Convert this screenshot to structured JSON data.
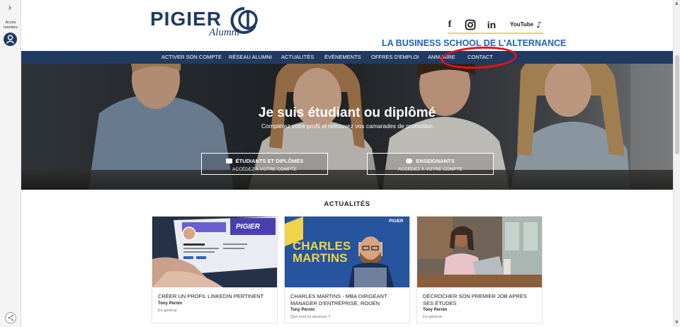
{
  "rail": {
    "toggle_glyph": "›",
    "label_line1": "Accès",
    "label_line2": "membre",
    "avatar_icon": "person-icon",
    "share_icon": "share-icon"
  },
  "header": {
    "logo_word": "PIGIER",
    "logo_sub": "Alumni",
    "tagline": "LA BUSINESS SCHOOL DE L'ALTERNANCE",
    "socials": {
      "facebook": "f",
      "instagram_icon": "instagram-icon",
      "linkedin": "in",
      "youtube": "YouTube",
      "tiktok": "♪"
    }
  },
  "nav": {
    "items": [
      "ACTIVER SON COMPTE",
      "RÉSEAU ALUMNI",
      "ACTUALITÉS",
      "ÉVÉNEMENTS",
      "OFFRES D'EMPLOI",
      "ANNUAIRE",
      "CONTACT"
    ]
  },
  "hero": {
    "title": "Je suis étudiant ou diplômé",
    "subtitle": "Complétez votre profil et retrouvez vos camarades de promotion",
    "buttons": [
      {
        "label": "ÉTUDIANTS ET DIPLÔMÉS",
        "sub": "ACCÉDEZ À VOTRE COMPTE",
        "icon": "book-icon"
      },
      {
        "label": "ENSEIGNANTS",
        "sub": "ACCÉDEZ À VOTRE COMPTE",
        "icon": "chat-icon"
      }
    ]
  },
  "news": {
    "title": "ACTUALITÉS",
    "cards": [
      {
        "title": "CRÉER UN PROFIL LINKEDIN PERTINENT",
        "author": "Tony Pernin",
        "category": "En général",
        "image_brand": "PIGIER"
      },
      {
        "title": "CHARLES MARTINS - MBA DIRIGEANT MANAGER D'ENTREPRISE, ROUEN",
        "author": "Tony Pernin",
        "category": "Que sont-ils devenus ?",
        "image_text_1": "CHARLES",
        "image_text_2": "MARTINS",
        "image_tag": "PORTRAIT A",
        "image_brand": "PIGIER"
      },
      {
        "title": "DÉCROCHER SON PREMIER JOB APRÈS SES ÉTUDES",
        "author": "Tony Pernin",
        "category": "En général"
      }
    ]
  },
  "colors": {
    "navy": "#213a61",
    "brand_blue": "#1f63b5",
    "accent_yellow": "#f2d44b",
    "highlight_red": "#e8121b"
  }
}
